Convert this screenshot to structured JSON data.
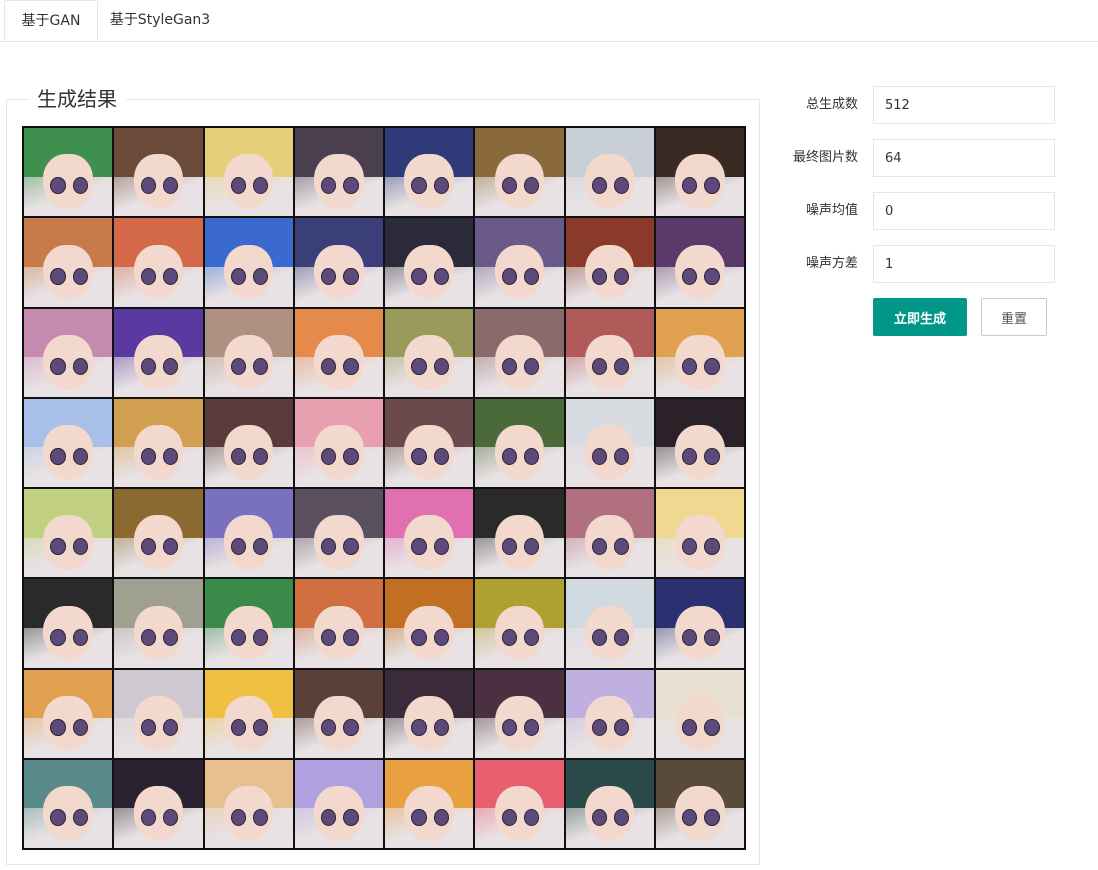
{
  "tabs": [
    {
      "label": "基于GAN",
      "active": true
    },
    {
      "label": "基于StyleGan3",
      "active": false
    }
  ],
  "result_panel": {
    "title": "生成结果",
    "image_description_rows": 8,
    "image_description_cols": 8
  },
  "form": {
    "fields": [
      {
        "label": "总生成数",
        "value": "512"
      },
      {
        "label": "最终图片数",
        "value": "64"
      },
      {
        "label": "噪声均值",
        "value": "0"
      },
      {
        "label": "噪声方差",
        "value": "1"
      }
    ],
    "generate_label": "立即生成",
    "reset_label": "重置"
  },
  "colors": {
    "primary": "#009688",
    "border": "#e6e6e6",
    "hair_palette": [
      "#3f8f4f",
      "#6b4a3a",
      "#e6cf7a",
      "#4a3f4f",
      "#2f3a7a",
      "#8a6a3a",
      "#c9cfd6",
      "#3a2a24",
      "#c97a4a",
      "#d4694a",
      "#3a6ad0",
      "#3a3f7a",
      "#2a2a3a",
      "#6a5a8a",
      "#8a3a2a",
      "#5a3a6a",
      "#c48ab0",
      "#5a3aa0",
      "#b09080",
      "#e48a4a",
      "#9a9a5a",
      "#8a6a6a",
      "#b05a5a",
      "#e0a050",
      "#a8c0e8",
      "#d0a050",
      "#5a3a3a",
      "#e8a0b0",
      "#6a4a4a",
      "#4a6a3a",
      "#d8dce0",
      "#2a2228",
      "#c0d080",
      "#8a6a30",
      "#7a70c0",
      "#5a5060",
      "#e070b0",
      "#2a2a2a",
      "#b07080",
      "#f0d890",
      "#2a2a2a",
      "#a0a090",
      "#3a8a4a",
      "#d07040",
      "#c07020",
      "#b0a030",
      "#d0d8e0",
      "#2a3070",
      "#e0a050",
      "#d0c8d0",
      "#f0c040",
      "#5a4038",
      "#3a2a3a",
      "#4a3040",
      "#c0b0e0",
      "#e8e0d0",
      "#5a8a8a",
      "#2a2230",
      "#e8c090",
      "#b0a0e0",
      "#e8a040",
      "#e86070",
      "#2a4a4a",
      "#5a4a3a"
    ]
  }
}
